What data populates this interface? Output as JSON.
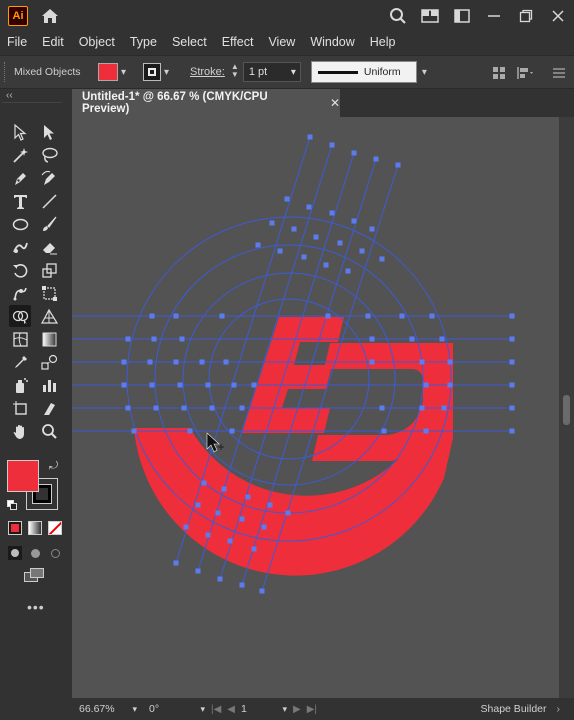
{
  "app": {
    "logo_text": "Ai",
    "icons": [
      "home-icon",
      "search-icon",
      "workspace-icon",
      "minimize-icon",
      "restore-icon",
      "close-icon"
    ]
  },
  "menu": [
    "File",
    "Edit",
    "Object",
    "Type",
    "Select",
    "Effect",
    "View",
    "Window",
    "Help"
  ],
  "control_bar": {
    "selection_label": "Mixed Objects",
    "fill_color": "#ee2e3a",
    "stroke_label": "Stroke:",
    "stroke_weight": "1 pt",
    "stroke_profile": "Uniform"
  },
  "document": {
    "tab_title": "Untitled-1* @ 66.67 % (CMYK/CPU Preview)",
    "close": "✕"
  },
  "artwork": {
    "logo_color": "#ee2e3a",
    "guide_color": "#3d5bd6",
    "anchor_color": "#5b7cf0"
  },
  "tools": [
    {
      "name": "selection-tool"
    },
    {
      "name": "direct-selection-tool"
    },
    {
      "name": "magic-wand-tool"
    },
    {
      "name": "lasso-tool"
    },
    {
      "name": "pen-tool"
    },
    {
      "name": "curvature-tool"
    },
    {
      "name": "type-tool"
    },
    {
      "name": "line-segment-tool"
    },
    {
      "name": "ellipse-tool"
    },
    {
      "name": "paintbrush-tool"
    },
    {
      "name": "shaper-tool"
    },
    {
      "name": "eraser-tool"
    },
    {
      "name": "rotate-tool"
    },
    {
      "name": "scale-tool"
    },
    {
      "name": "puppet-warp-tool"
    },
    {
      "name": "free-transform-tool"
    },
    {
      "name": "shape-builder-tool"
    },
    {
      "name": "perspective-grid-tool"
    },
    {
      "name": "mesh-tool"
    },
    {
      "name": "gradient-tool"
    },
    {
      "name": "eyedropper-tool"
    },
    {
      "name": "blend-tool"
    },
    {
      "name": "symbol-sprayer-tool"
    },
    {
      "name": "column-graph-tool"
    },
    {
      "name": "artboard-tool"
    },
    {
      "name": "slice-tool"
    },
    {
      "name": "hand-tool"
    },
    {
      "name": "zoom-tool"
    }
  ],
  "swatches": {
    "fill": "#ee2e3a",
    "stroke": "#000000"
  },
  "status": {
    "zoom": "66.67%",
    "rotation": "0°",
    "artboard": "1",
    "tool_name": "Shape Builder"
  }
}
